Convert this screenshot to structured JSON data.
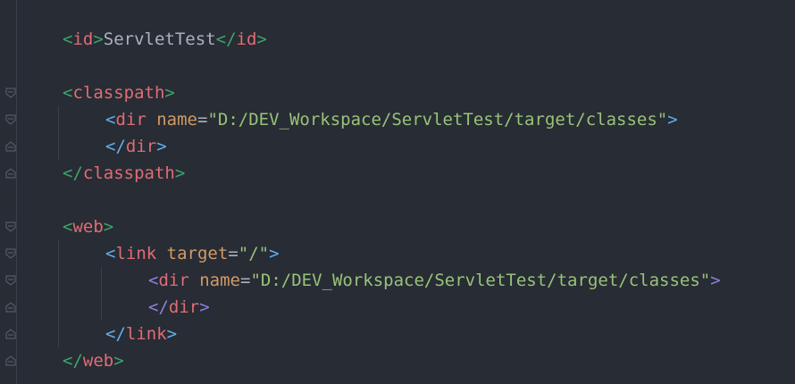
{
  "lines": {
    "id_open": "id",
    "id_text": "ServletTest",
    "id_close": "id",
    "classpath_open": "classpath",
    "cp_dir_tag": "dir",
    "cp_dir_attr": "name",
    "cp_dir_value": "\"D:/DEV_Workspace/ServletTest/target/classes\"",
    "cp_dir_close": "dir",
    "classpath_close": "classpath",
    "web_open": "web",
    "link_tag": "link",
    "link_attr": "target",
    "link_value": "\"/\"",
    "web_dir_tag": "dir",
    "web_dir_attr": "name",
    "web_dir_value": "\"D:/DEV_Workspace/ServletTest/target/classes\"",
    "web_dir_close": "dir",
    "link_close": "link",
    "web_close": "web"
  },
  "colors": {
    "background": "#282c34",
    "tag": "#e06c75",
    "attribute": "#d19a66",
    "value": "#98c379",
    "bracket_green": "#3fa36b",
    "bracket_blue": "#61afef",
    "bracket_violet": "#8f7fe0"
  },
  "icons": [
    "fold-open-icon",
    "fold-close-icon"
  ]
}
